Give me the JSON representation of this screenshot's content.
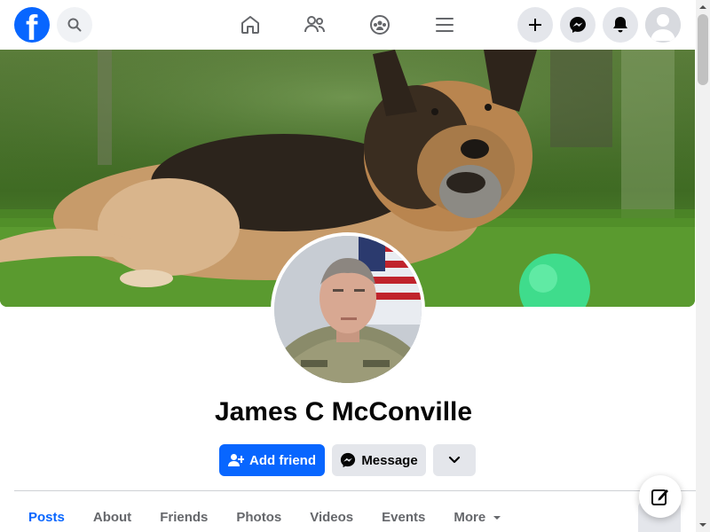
{
  "topbar": {
    "logo": "facebook-logo",
    "logo_letter": "f",
    "search_icon": "search-icon",
    "nav_icons": [
      "home-icon",
      "friends-icon",
      "groups-icon",
      "menu-icon"
    ],
    "actions": [
      "create-plus-icon",
      "messenger-icon",
      "notifications-bell-icon"
    ],
    "avatar": "account-avatar"
  },
  "profile": {
    "name": "James C McConville",
    "cover_image": "german-shepherd-on-grass",
    "profile_image": "man-in-camouflage-uniform"
  },
  "actions": {
    "add_friend": "Add friend",
    "message": "Message",
    "more_icon": "chevron-down-icon"
  },
  "tabs": [
    {
      "label": "Posts",
      "active": true
    },
    {
      "label": "About"
    },
    {
      "label": "Friends"
    },
    {
      "label": "Photos"
    },
    {
      "label": "Videos"
    },
    {
      "label": "Events"
    },
    {
      "label": "More"
    }
  ],
  "colors": {
    "brand": "#0866ff",
    "button_gray": "#e4e6eb",
    "text_secondary": "#65676b"
  }
}
